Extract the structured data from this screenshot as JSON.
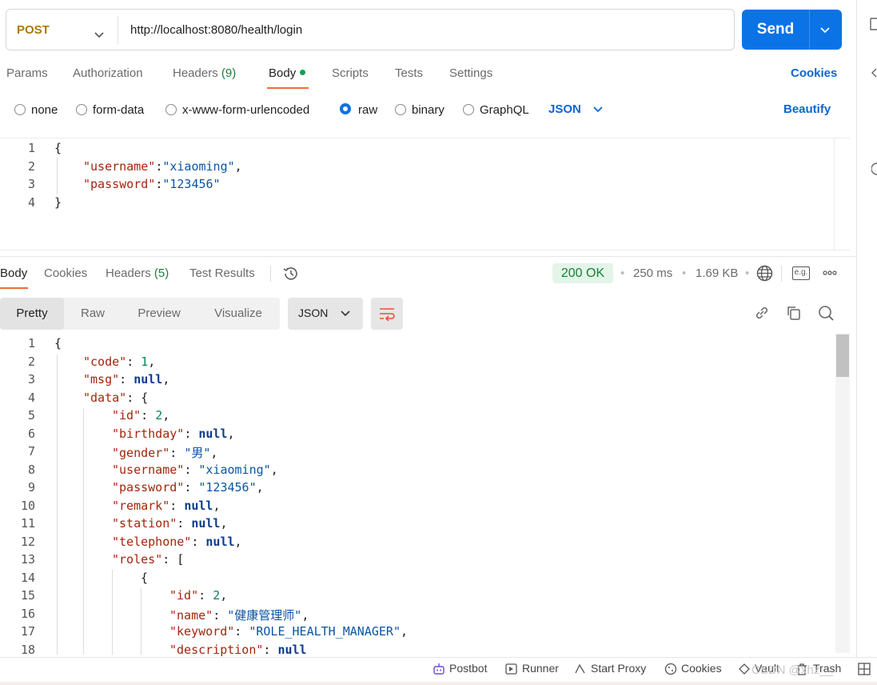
{
  "request": {
    "method": "POST",
    "url": "http://localhost:8080/health/login",
    "send_label": "Send"
  },
  "request_tabs": {
    "params": "Params",
    "authorization": "Authorization",
    "headers": "Headers",
    "headers_count": "(9)",
    "body": "Body",
    "scripts": "Scripts",
    "tests": "Tests",
    "settings": "Settings",
    "cookies": "Cookies"
  },
  "body_types": {
    "none": "none",
    "form_data": "form-data",
    "urlencoded": "x-www-form-urlencoded",
    "raw": "raw",
    "binary": "binary",
    "graphql": "GraphQL",
    "selected": "raw",
    "format": "JSON",
    "beautify": "Beautify"
  },
  "request_body": {
    "line_numbers": [
      "1",
      "2",
      "3",
      "4"
    ],
    "lines": [
      {
        "open": "{"
      },
      {
        "key": "\"username\"",
        "sep": ":",
        "value": "\"xiaoming\"",
        "trail": ","
      },
      {
        "key": "\"password\"",
        "sep": ":",
        "value": "\"123456\"",
        "trail": ""
      },
      {
        "close": "}"
      }
    ]
  },
  "response_tabs": {
    "body": "Body",
    "cookies": "Cookies",
    "headers": "Headers",
    "headers_count": "(5)",
    "test_results": "Test Results"
  },
  "response_meta": {
    "status": "200 OK",
    "time": "250 ms",
    "size": "1.69 KB",
    "eg": "e.g."
  },
  "view_modes": {
    "pretty": "Pretty",
    "raw": "Raw",
    "preview": "Preview",
    "visualize": "Visualize",
    "format": "JSON"
  },
  "response_body": {
    "line_numbers": [
      "1",
      "2",
      "3",
      "4",
      "5",
      "6",
      "7",
      "8",
      "9",
      "10",
      "11",
      "12",
      "13",
      "14",
      "15",
      "16",
      "17",
      "18"
    ],
    "lines": [
      {
        "text": "{"
      },
      {
        "key": "\"code\"",
        "sep": ": ",
        "value": "1",
        "vtype": "n",
        "trail": ","
      },
      {
        "key": "\"msg\"",
        "sep": ": ",
        "value": "null",
        "vtype": "nl",
        "trail": ","
      },
      {
        "key": "\"data\"",
        "sep": ": ",
        "value": "{",
        "vtype": "p",
        "trail": ""
      },
      {
        "key": "\"id\"",
        "sep": ": ",
        "value": "2",
        "vtype": "n",
        "trail": ","
      },
      {
        "key": "\"birthday\"",
        "sep": ": ",
        "value": "null",
        "vtype": "nl",
        "trail": ","
      },
      {
        "key": "\"gender\"",
        "sep": ": ",
        "value": "\"男\"",
        "vtype": "s",
        "trail": ","
      },
      {
        "key": "\"username\"",
        "sep": ": ",
        "value": "\"xiaoming\"",
        "vtype": "s",
        "trail": ","
      },
      {
        "key": "\"password\"",
        "sep": ": ",
        "value": "\"123456\"",
        "vtype": "s",
        "trail": ","
      },
      {
        "key": "\"remark\"",
        "sep": ": ",
        "value": "null",
        "vtype": "nl",
        "trail": ","
      },
      {
        "key": "\"station\"",
        "sep": ": ",
        "value": "null",
        "vtype": "nl",
        "trail": ","
      },
      {
        "key": "\"telephone\"",
        "sep": ": ",
        "value": "null",
        "vtype": "nl",
        "trail": ","
      },
      {
        "key": "\"roles\"",
        "sep": ": ",
        "value": "[",
        "vtype": "p",
        "trail": ""
      },
      {
        "text": "{"
      },
      {
        "key": "\"id\"",
        "sep": ": ",
        "value": "2",
        "vtype": "n",
        "trail": ","
      },
      {
        "key": "\"name\"",
        "sep": ": ",
        "value": "\"健康管理师\"",
        "vtype": "s",
        "trail": ","
      },
      {
        "key": "\"keyword\"",
        "sep": ": ",
        "value": "\"ROLE_HEALTH_MANAGER\"",
        "vtype": "s",
        "trail": ","
      },
      {
        "key": "\"description\"",
        "sep": ": ",
        "value": "null",
        "vtype": "nl",
        "trail": ""
      }
    ]
  },
  "footer": {
    "postbot": "Postbot",
    "runner": "Runner",
    "start_proxy": "Start Proxy",
    "cookies": "Cookies",
    "vault": "Vault",
    "trash": "Trash"
  },
  "watermark": "CSDN @xhz__"
}
